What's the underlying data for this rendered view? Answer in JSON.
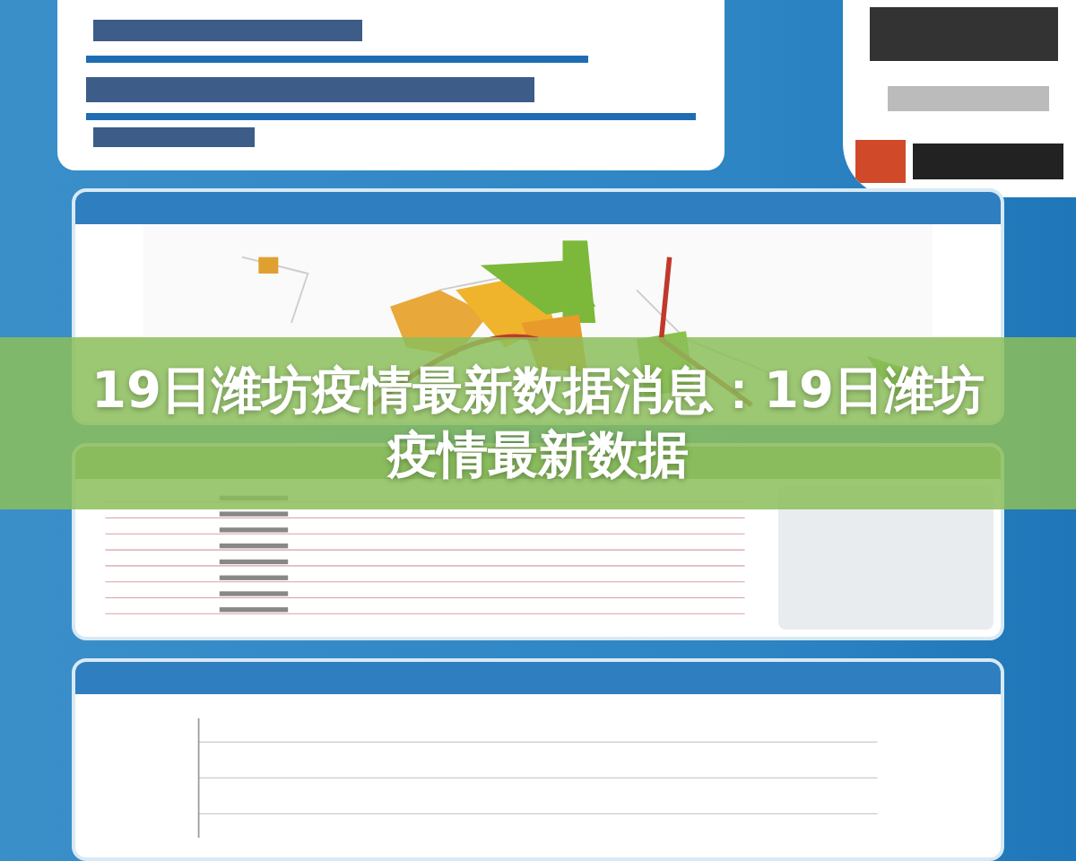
{
  "banner": {
    "title": "19日潍坊疫情最新数据消息：19日潍坊疫情最新数据"
  }
}
